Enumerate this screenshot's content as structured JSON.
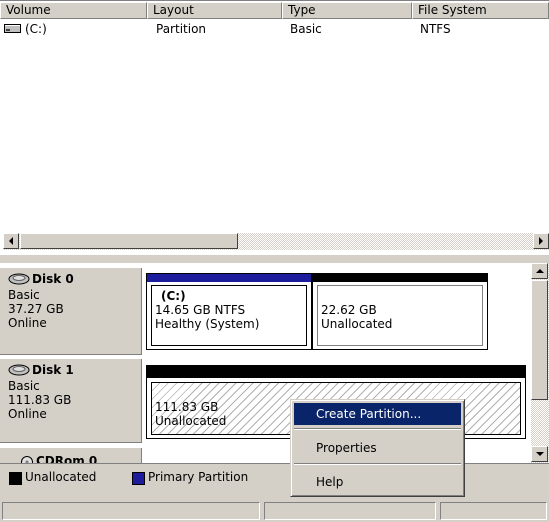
{
  "volume_list": {
    "columns": [
      "Volume",
      "Layout",
      "Type",
      "File System"
    ],
    "rows": [
      {
        "volume": "(C:)",
        "layout": "Partition",
        "type": "Basic",
        "file_system": "NTFS",
        "icon": "drive-icon"
      }
    ]
  },
  "disks": [
    {
      "name": "Disk 0",
      "type": "Basic",
      "size": "37.27 GB",
      "status": "Online",
      "partitions": [
        {
          "label": "(C:)",
          "size": "14.65 GB NTFS",
          "status": "Healthy (System)",
          "bar_color": "#1c1c9c"
        },
        {
          "label": "",
          "size": "22.62 GB",
          "status": "Unallocated",
          "bar_color": "#000000"
        }
      ]
    },
    {
      "name": "Disk 1",
      "type": "Basic",
      "size": "111.83 GB",
      "status": "Online",
      "partitions": [
        {
          "label": "",
          "size": "111.83 GB",
          "status": "Unallocated",
          "bar_color": "#000000"
        }
      ]
    },
    {
      "name": "CDRom 0"
    }
  ],
  "legend": {
    "items": [
      {
        "label": "Unallocated",
        "color": "#000000"
      },
      {
        "label": "Primary Partition",
        "color": "#1c1c9c"
      }
    ]
  },
  "context_menu": {
    "items": [
      {
        "label": "Create Partition...",
        "selected": true
      },
      {
        "label": "Properties",
        "selected": false
      },
      {
        "label": "Help",
        "selected": false
      }
    ]
  },
  "colors": {
    "selection": "#0a246a",
    "primary_partition": "#1c1c9c",
    "unallocated": "#000000",
    "window_face": "#d4d0c8"
  }
}
